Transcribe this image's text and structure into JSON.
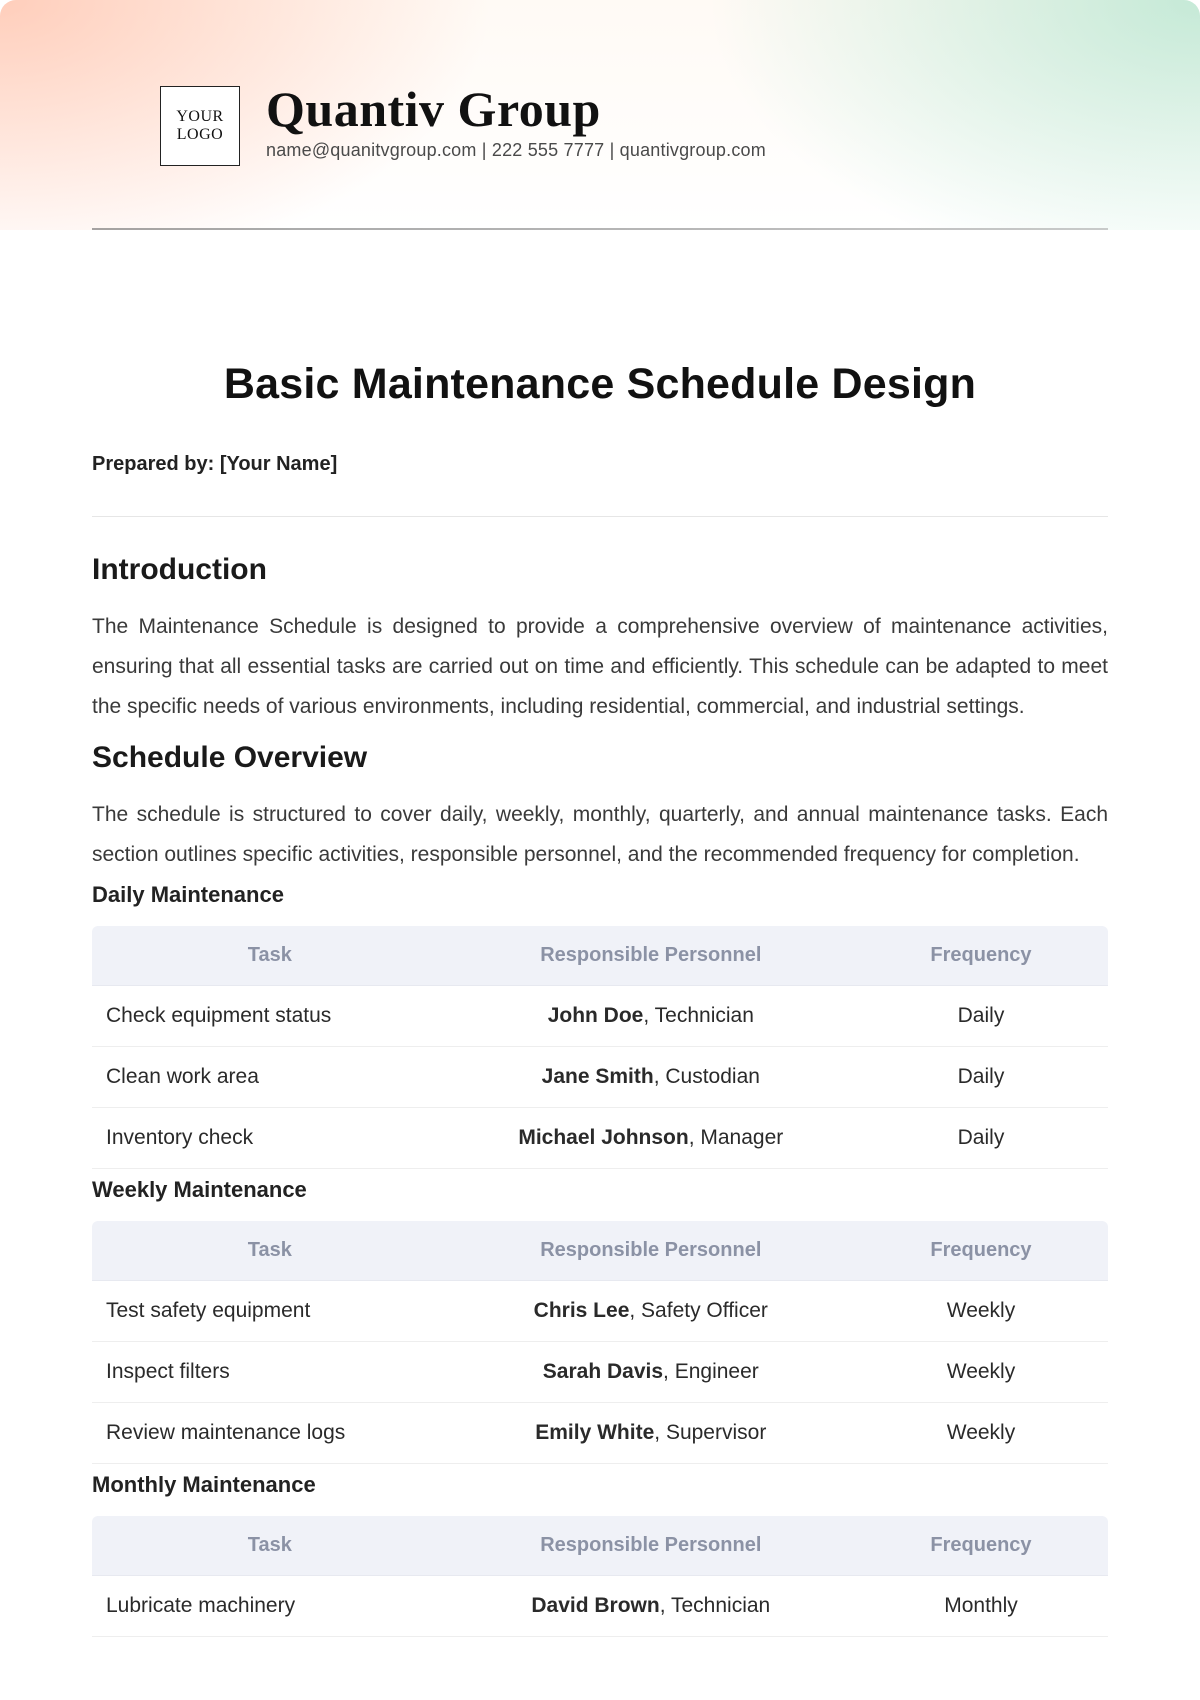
{
  "header": {
    "logo_text": "YOUR\nLOGO",
    "company_name": "Quantiv Group",
    "contact_line": "name@quanitvgroup.com | 222 555 7777 | quantivgroup.com"
  },
  "doc": {
    "title": "Basic Maintenance Schedule Design",
    "prepared_by_label": "Prepared by: [Your Name]"
  },
  "sections": {
    "intro": {
      "heading": "Introduction",
      "text": "The Maintenance Schedule is designed to provide a comprehensive overview of maintenance activities, ensuring that all essential tasks are carried out on time and efficiently. This schedule can be adapted to meet the specific needs of various environments, including residential, commercial, and industrial settings."
    },
    "overview": {
      "heading": "Schedule Overview",
      "text": "The schedule is structured to cover daily, weekly, monthly, quarterly, and annual maintenance tasks. Each section outlines specific activities, responsible personnel, and the recommended frequency for completion."
    }
  },
  "table_headers": {
    "task": "Task",
    "person": "Responsible Personnel",
    "freq": "Frequency"
  },
  "daily": {
    "heading": "Daily Maintenance",
    "rows": [
      {
        "task": "Check equipment status",
        "name": "John Doe",
        "role": "Technician",
        "freq": "Daily"
      },
      {
        "task": "Clean work area",
        "name": "Jane Smith",
        "role": "Custodian",
        "freq": "Daily"
      },
      {
        "task": "Inventory check",
        "name": "Michael Johnson",
        "role": "Manager",
        "freq": "Daily"
      }
    ]
  },
  "weekly": {
    "heading": "Weekly Maintenance",
    "rows": [
      {
        "task": "Test safety equipment",
        "name": "Chris Lee",
        "role": "Safety Officer",
        "freq": "Weekly"
      },
      {
        "task": "Inspect filters",
        "name": "Sarah Davis",
        "role": "Engineer",
        "freq": "Weekly"
      },
      {
        "task": "Review maintenance logs",
        "name": "Emily White",
        "role": "Supervisor",
        "freq": "Weekly"
      }
    ]
  },
  "monthly": {
    "heading": "Monthly Maintenance",
    "rows": [
      {
        "task": "Lubricate machinery",
        "name": "David Brown",
        "role": "Technician",
        "freq": "Monthly"
      }
    ]
  }
}
